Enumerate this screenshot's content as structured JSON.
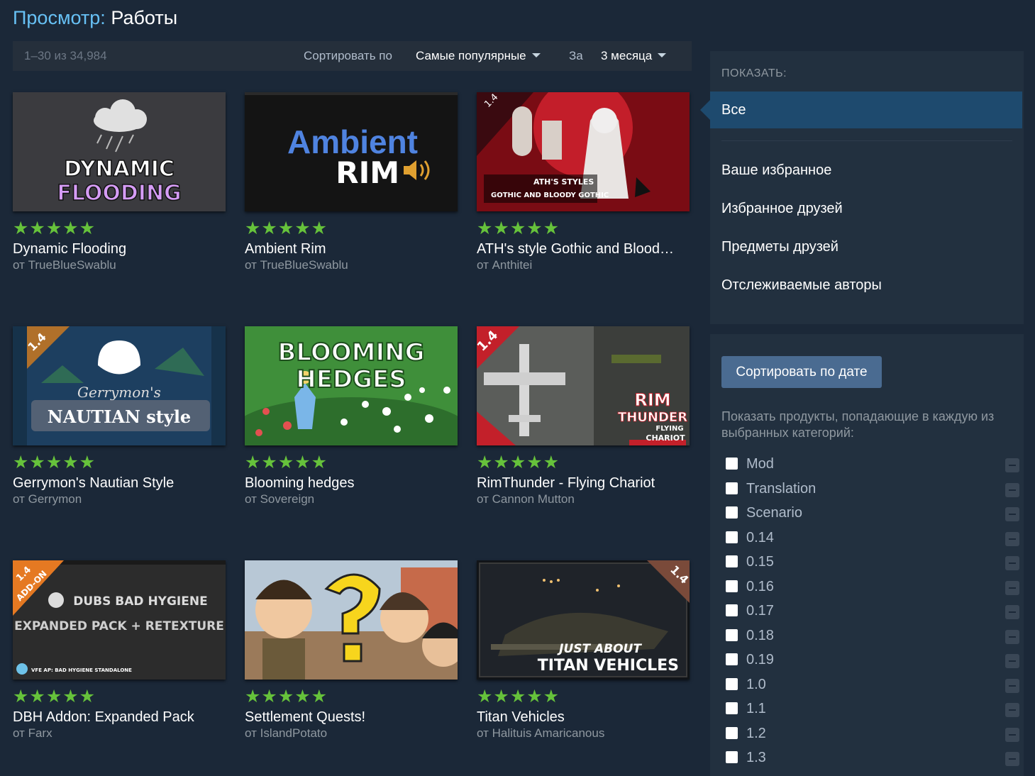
{
  "page": {
    "title_prefix": "Просмотр:",
    "title_main": "Работы"
  },
  "sortbar": {
    "count": "1–30 из 34,984",
    "sort_label": "Сортировать по",
    "sort_value": "Самые популярные",
    "period_label": "За",
    "period_value": "3 месяца"
  },
  "items": [
    {
      "title": "Dynamic Flooding",
      "author": "от TrueBlueSwablu",
      "stars": "★★★★★",
      "thumb_text1": "DYNAMIC",
      "thumb_text2": "FLOODING"
    },
    {
      "title": "Ambient Rim",
      "author": "от TrueBlueSwablu",
      "stars": "★★★★★",
      "thumb_text1": "Ambient",
      "thumb_text2": "RIM"
    },
    {
      "title": "ATH's style Gothic and Blood…",
      "author": "от Anthitei",
      "stars": "★★★★★",
      "thumb_text1": "ATH'S STYLES",
      "thumb_text2": "GOTHIC AND BLOODY GOTHIC",
      "thumb_badge": "1.4"
    },
    {
      "title": "Gerrymon's Nautian Style",
      "author": "от Gerrymon",
      "stars": "★★★★★",
      "thumb_text1": "Gerrymon's",
      "thumb_text2": "NAUTIAN style",
      "thumb_badge": "1.4"
    },
    {
      "title": "Blooming hedges",
      "author": "от Sovereign",
      "stars": "★★★★★",
      "thumb_text1": "BLOOMING",
      "thumb_text2": "HEDGES"
    },
    {
      "title": "RimThunder - Flying Chariot",
      "author": "от Cannon Mutton",
      "stars": "★★★★★",
      "thumb_text1": "RIM",
      "thumb_text2": "THUNDER",
      "thumb_text3": "FLYING",
      "thumb_text4": "CHARIOT",
      "thumb_badge": "1.4"
    },
    {
      "title": "DBH Addon: Expanded Pack",
      "author": "от Farx",
      "stars": "★★★★★",
      "thumb_text1": "DUBS BAD HYGIENE",
      "thumb_text2": "EXPANDED PACK + RETEXTURE",
      "thumb_text3": "VFE AP: BAD HYGIENE STANDALONE",
      "thumb_badge": "1.4",
      "thumb_badge2": "ADD-ON"
    },
    {
      "title": "Settlement Quests!",
      "author": "от IslandPotato",
      "stars": "★★★★★"
    },
    {
      "title": "Titan Vehicles",
      "author": "от Halituis Amaricanous",
      "stars": "★★★★★",
      "thumb_text1": "JUST ABOUT",
      "thumb_text2": "TITAN VEHICLES",
      "thumb_badge": "1.4"
    }
  ],
  "sidebar": {
    "show_label": "ПОКАЗАТЬ:",
    "all": "Все",
    "nav": [
      "Ваше избранное",
      "Избранное друзей",
      "Предметы друзей",
      "Отслеживаемые авторы"
    ],
    "sort_by_date": "Сортировать по дате",
    "categories_desc": "Показать продукты, попадающие в каждую из выбранных категорий:",
    "categories": [
      "Mod",
      "Translation",
      "Scenario",
      "0.14",
      "0.15",
      "0.16",
      "0.17",
      "0.18",
      "0.19",
      "1.0",
      "1.1",
      "1.2",
      "1.3"
    ]
  },
  "colors": {
    "background": "#1b2838",
    "panel": "#22303f",
    "selected": "#1e4a6e",
    "accent": "#67c1f5",
    "stars": "#66c23b",
    "button": "#4a6b91"
  }
}
